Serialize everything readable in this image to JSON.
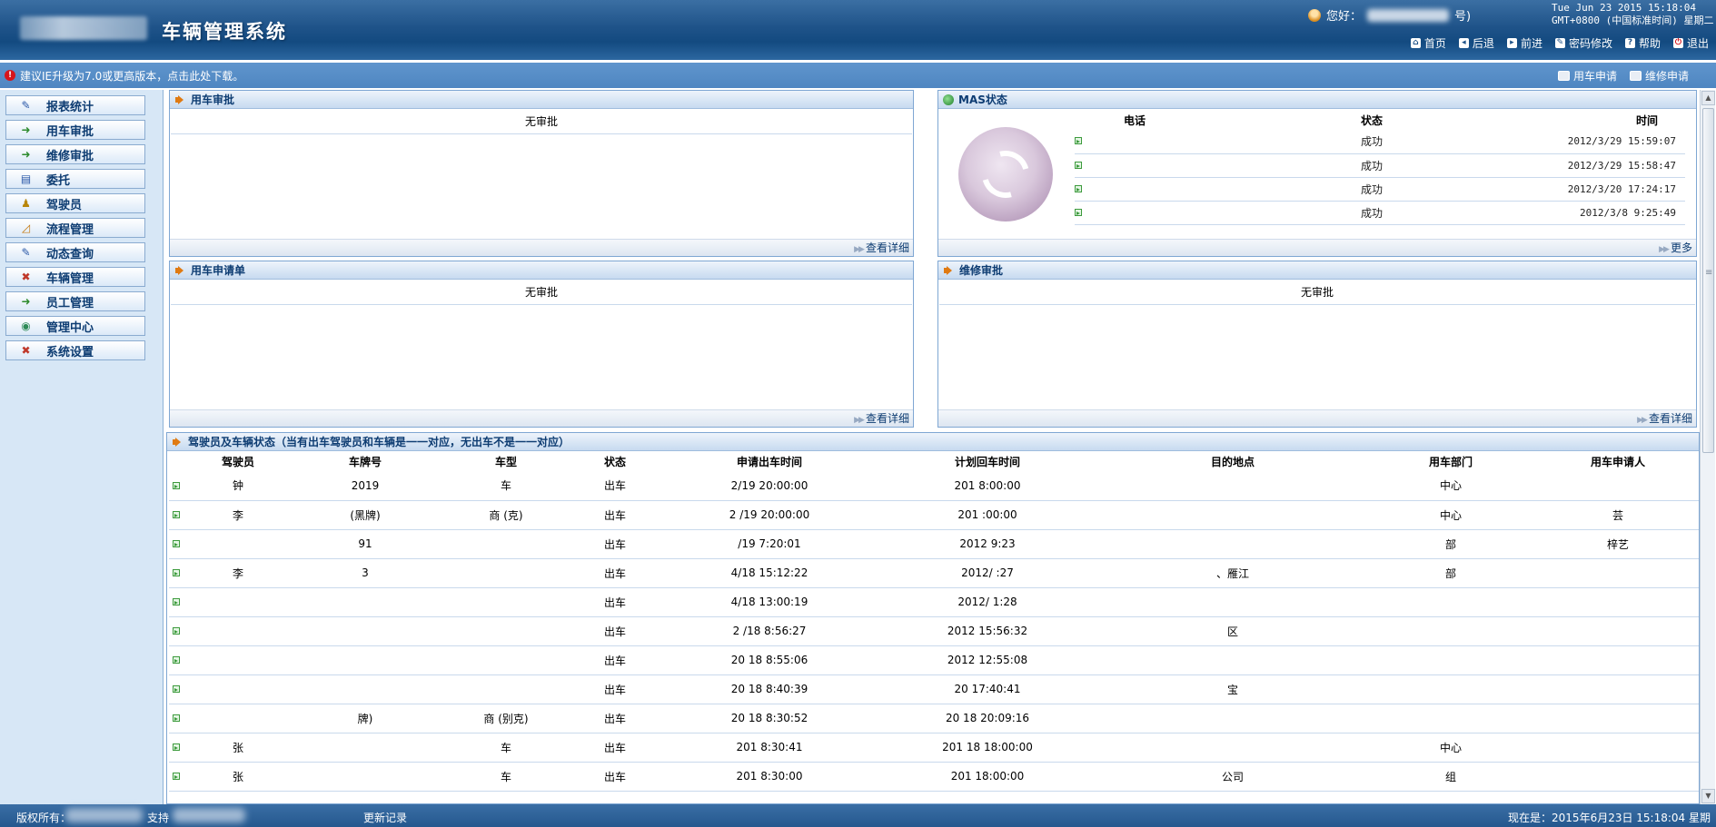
{
  "header": {
    "app_title": "车辆管理系统",
    "greeting": "您好：",
    "greeting_suffix": "号)",
    "clock_line1": "Tue Jun 23 2015 15:18:04",
    "clock_line2": "GMT+0800 (中国标准时间) 星期二",
    "links": [
      {
        "label": "首页",
        "icon": "home-icon"
      },
      {
        "label": "后退",
        "icon": "back-icon"
      },
      {
        "label": "前进",
        "icon": "forward-icon"
      },
      {
        "label": "密码修改",
        "icon": "password-icon"
      },
      {
        "label": "帮助",
        "icon": "help-icon"
      },
      {
        "label": "退出",
        "icon": "logout-icon"
      }
    ]
  },
  "notice": {
    "text": "建议IE升级为7.0或更高版本，点击此处下载。",
    "quick_links": [
      {
        "label": "用车申请"
      },
      {
        "label": "维修申请"
      }
    ]
  },
  "sidebar": {
    "items": [
      {
        "label": "报表统计",
        "icon": "✎"
      },
      {
        "label": "用车审批",
        "icon": "➜"
      },
      {
        "label": "维修审批",
        "icon": "➜"
      },
      {
        "label": "委托",
        "icon": "▤"
      },
      {
        "label": "驾驶员",
        "icon": "♟"
      },
      {
        "label": "流程管理",
        "icon": "◿"
      },
      {
        "label": "动态查询",
        "icon": "✎"
      },
      {
        "label": "车辆管理",
        "icon": "✖"
      },
      {
        "label": "员工管理",
        "icon": "➜"
      },
      {
        "label": "管理中心",
        "icon": "◉"
      },
      {
        "label": "系统设置",
        "icon": "✖"
      }
    ]
  },
  "panels": {
    "approval": {
      "title": "用车审批",
      "empty": "无审批",
      "more": "查看详细"
    },
    "sms": {
      "title": "MAS状态",
      "headers": [
        "电话",
        "状态",
        "时间"
      ],
      "rows": [
        {
          "status": "成功",
          "time": "2012/3/29 15:59:07"
        },
        {
          "status": "成功",
          "time": "2012/3/29 15:58:47"
        },
        {
          "status": "成功",
          "time": "2012/3/20 17:24:17"
        },
        {
          "status": "成功",
          "time": "2012/3/8 9:25:49"
        }
      ],
      "more": "更多"
    },
    "request": {
      "title": "用车申请单",
      "empty": "无审批",
      "more": "查看详细"
    },
    "repair": {
      "title": "维修审批",
      "empty": "无审批",
      "more": "查看详细"
    },
    "drivers": {
      "title": "驾驶员及车辆状态（当有出车驾驶员和车辆是一一对应，无出车不是一一对应）",
      "headers": [
        "驾驶员",
        "车牌号",
        "车型",
        "状态",
        "申请出车时间",
        "计划回车时间",
        "目的地点",
        "用车部门",
        "用车申请人"
      ],
      "rows": [
        [
          "钟",
          "2019",
          "车",
          "出车",
          "2/19 20:00:00",
          "201 8:00:00",
          "",
          "中心",
          ""
        ],
        [
          "李",
          "(黑牌)",
          "商 (克)",
          "出车",
          "2 /19 20:00:00",
          "201 :00:00",
          "",
          "中心",
          "芸"
        ],
        [
          "",
          "91",
          "",
          "出车",
          "/19 7:20:01",
          "2012 9:23",
          "",
          "部",
          "梓艺"
        ],
        [
          "李",
          "3",
          "",
          "出车",
          "4/18 15:12:22",
          "2012/ :27",
          "、雁江",
          "部",
          ""
        ],
        [
          "",
          "",
          "",
          "出车",
          "4/18 13:00:19",
          "2012/ 1:28",
          "",
          "",
          ""
        ],
        [
          "",
          "",
          "",
          "出车",
          "2 /18 8:56:27",
          "2012 15:56:32",
          "区",
          "",
          ""
        ],
        [
          "",
          "",
          "",
          "出车",
          "20 18 8:55:06",
          "2012 12:55:08",
          "",
          "",
          ""
        ],
        [
          "",
          "",
          "",
          "出车",
          "20 18 8:40:39",
          "20 17:40:41",
          "宝",
          "",
          ""
        ],
        [
          "",
          "牌)",
          "商 (别克)",
          "出车",
          "20 18 8:30:52",
          "20 18 20:09:16",
          "",
          "",
          ""
        ],
        [
          "张",
          "",
          "车",
          "出车",
          "201 8:30:41",
          "201 18 18:00:00",
          "",
          "中心",
          ""
        ],
        [
          "张",
          "",
          "车",
          "出车",
          "201 8:30:00",
          "201 18:00:00",
          "公司",
          "组",
          ""
        ]
      ]
    }
  },
  "footer": {
    "copyright": "版权所有：",
    "support": "支持",
    "update_log": "更新记录",
    "now": "现在是：2015年6月23日 15:18:04 星期"
  }
}
